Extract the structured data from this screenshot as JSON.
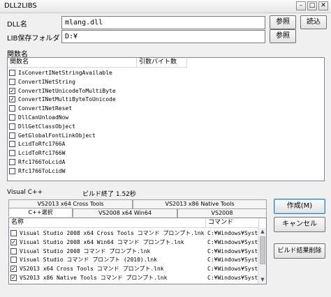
{
  "window": {
    "title": "DLL2LIBS",
    "minimize": "–",
    "maximize": "□",
    "close": "✕"
  },
  "form": {
    "dll_label": "DLL名",
    "dll_value": "mlang.dll",
    "lib_label": "LIB保存フォルダ",
    "lib_value": "D:¥",
    "browse1": "参照",
    "browse2": "参照",
    "load": "読込"
  },
  "functions": {
    "section_label": "関数名",
    "col_name": "関数名",
    "col_bytes": "引数バイト数",
    "items": [
      {
        "name": "IsConvertINetStringAvailable",
        "checked": false
      },
      {
        "name": "ConvertINetString",
        "checked": false
      },
      {
        "name": "ConvertINetUnicodeToMultiByte",
        "checked": true
      },
      {
        "name": "ConvertINetMultiByteToUnicode",
        "checked": true
      },
      {
        "name": "ConvertINetReset",
        "checked": false
      },
      {
        "name": "DllCanUnloadNow",
        "checked": false
      },
      {
        "name": "DllGetClassObject",
        "checked": false
      },
      {
        "name": "GetGlobalFontLinkObject",
        "checked": false
      },
      {
        "name": "LcidToRfc1766A",
        "checked": false
      },
      {
        "name": "LcidToRfc1766W",
        "checked": false
      },
      {
        "name": "Rfc1766ToLcidA",
        "checked": false
      },
      {
        "name": "Rfc1766ToLcidW",
        "checked": false
      }
    ]
  },
  "status": {
    "compiler": "Visual C++",
    "build": "ビルド終了 1.52秒"
  },
  "tabs": {
    "row1": [
      "VS2013 x64 Cross Tools",
      "VS2013 x86 Native Tools"
    ],
    "row2": [
      "C++選択",
      "VS2008 x64 Win64",
      "VS2008"
    ]
  },
  "tools": {
    "col_name": "名称",
    "col_cmd": "コマンド",
    "items": [
      {
        "name": "Visual Studio 2008 x64 Cross Tools コマンド プロンプト.lnk",
        "cmd": "C:¥Windows¥Syste",
        "checked": false
      },
      {
        "name": "Visual Studio 2008 x64 Win64 コマンド プロンプト.lnk",
        "cmd": "C:¥Windows¥Syste",
        "checked": true
      },
      {
        "name": "Visual Studio 2008 コマンド プロンプト.lnk",
        "cmd": "C:¥Windows¥Syste",
        "checked": false
      },
      {
        "name": "Visual Studio コマンド プロンプト (2010).lnk",
        "cmd": "C:¥Windows¥Syste",
        "checked": false
      },
      {
        "name": "VS2013 x64 Cross Tools コマンド プロンプト.lnk",
        "cmd": "C:¥Windows¥Syste",
        "checked": true
      },
      {
        "name": "VS2013 x86 Native Tools コマンド プロンプト.lnk",
        "cmd": "C:¥Windows¥Syste",
        "checked": true
      }
    ]
  },
  "actions": {
    "create": "作成(M)",
    "cancel": "キャンセル",
    "delete_results": "ビルド結果削除"
  }
}
